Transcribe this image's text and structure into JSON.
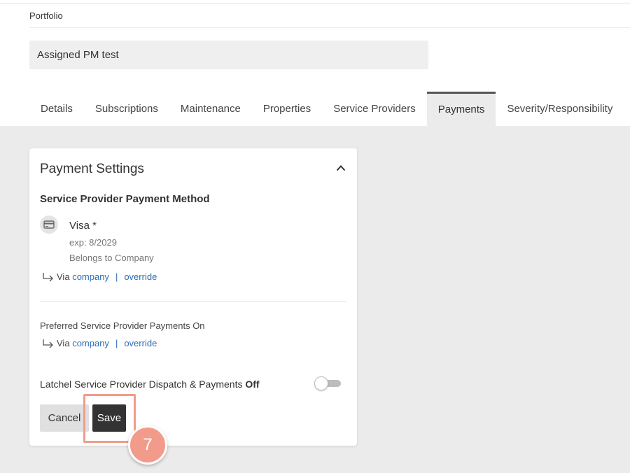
{
  "header": {
    "portfolio_label": "Portfolio",
    "name_value": "Assigned PM test"
  },
  "tabs": [
    {
      "label": "Details"
    },
    {
      "label": "Subscriptions"
    },
    {
      "label": "Maintenance"
    },
    {
      "label": "Properties"
    },
    {
      "label": "Service Providers"
    },
    {
      "label": "Payments",
      "active": true
    },
    {
      "label": "Severity/Responsibility"
    }
  ],
  "payment_settings": {
    "title": "Payment Settings",
    "method_section": {
      "title": "Service Provider Payment Method",
      "card_brand": "Visa *",
      "expiry": "exp: 8/2029",
      "owner": "Belongs to Company",
      "via_label": "Via",
      "via_link": "company",
      "separator": "|",
      "override_link": "override"
    },
    "preferred_section": {
      "label": "Preferred Service Provider Payments On",
      "via_label": "Via",
      "via_link": "company",
      "separator": "|",
      "override_link": "override"
    },
    "dispatch": {
      "label": "Latchel Service Provider Dispatch & Payments",
      "state": "Off",
      "enabled": false
    },
    "cancel_label": "Cancel",
    "save_label": "Save"
  },
  "annotation": {
    "step_number": "7",
    "color": "#f39b8b"
  },
  "icons": {
    "collapse": "chevron-up-icon",
    "card": "credit-card-icon",
    "via": "return-arrow-icon"
  }
}
